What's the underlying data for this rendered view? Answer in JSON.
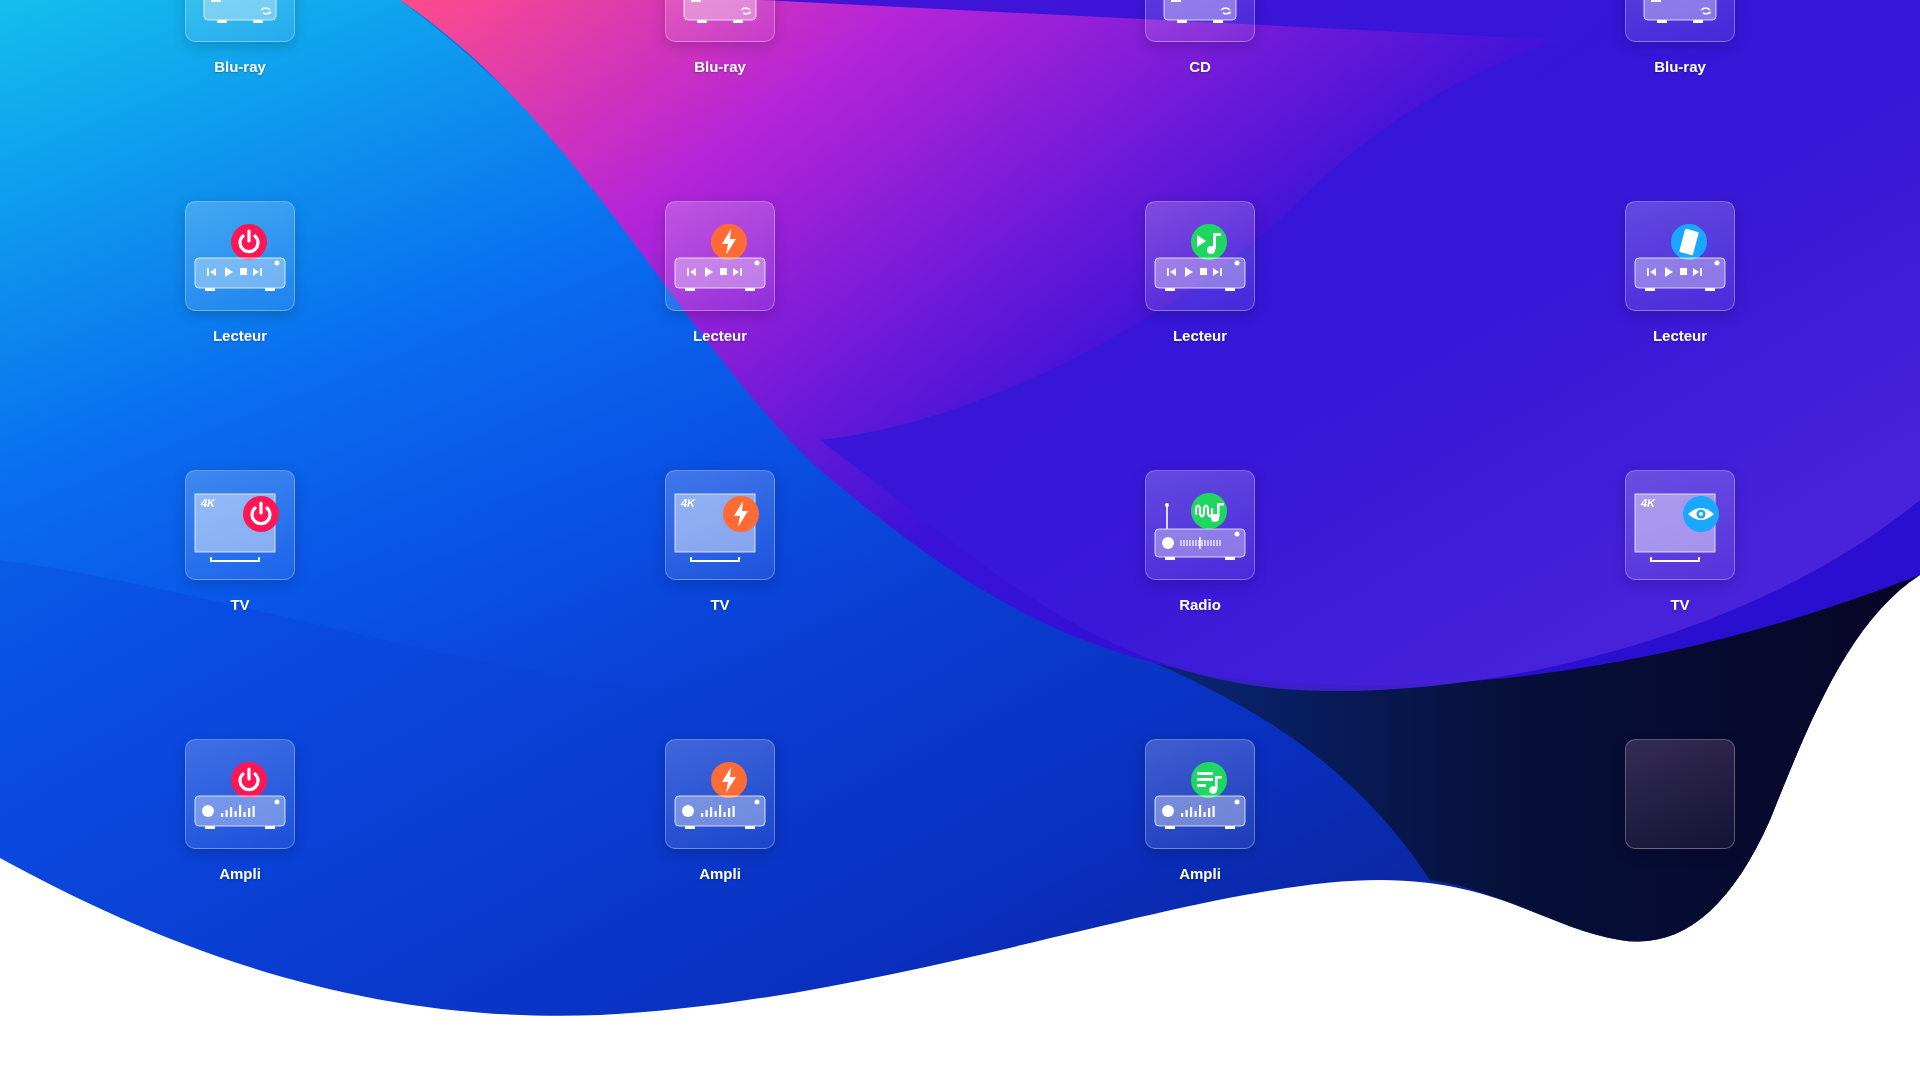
{
  "devices": [
    {
      "kind": "disc",
      "label": "Blu-ray"
    },
    {
      "kind": "disc",
      "label": "Blu-ray"
    },
    {
      "kind": "disc",
      "label": "CD"
    },
    {
      "kind": "disc",
      "label": "Blu-ray"
    },
    {
      "kind": "player",
      "label": "Lecteur",
      "badge": {
        "kind": "power",
        "color": "#ff1654"
      }
    },
    {
      "kind": "player",
      "label": "Lecteur",
      "badge": {
        "kind": "bolt",
        "color": "#ff6b35"
      }
    },
    {
      "kind": "player",
      "label": "Lecteur",
      "badge": {
        "kind": "music",
        "color": "#1ed760"
      }
    },
    {
      "kind": "player",
      "label": "Lecteur",
      "badge": {
        "kind": "film",
        "color": "#19a7ff"
      }
    },
    {
      "kind": "tv",
      "label": "TV",
      "resolution": "4K",
      "badge": {
        "kind": "power",
        "color": "#ff1654"
      }
    },
    {
      "kind": "tv",
      "label": "TV",
      "resolution": "4K",
      "badge": {
        "kind": "bolt",
        "color": "#ff6b35"
      }
    },
    {
      "kind": "radio",
      "label": "Radio",
      "badge": {
        "kind": "wave",
        "color": "#1ed760"
      }
    },
    {
      "kind": "tv",
      "label": "TV",
      "resolution": "4K",
      "badge": {
        "kind": "eye",
        "color": "#19a7ff"
      }
    },
    {
      "kind": "amp",
      "label": "Ampli",
      "badge": {
        "kind": "power",
        "color": "#ff1654"
      }
    },
    {
      "kind": "amp",
      "label": "Ampli",
      "badge": {
        "kind": "bolt",
        "color": "#ff6b35"
      }
    },
    {
      "kind": "amp",
      "label": "Ampli",
      "badge": {
        "kind": "playlist",
        "color": "#1ed760"
      }
    },
    {
      "kind": "empty"
    }
  ]
}
